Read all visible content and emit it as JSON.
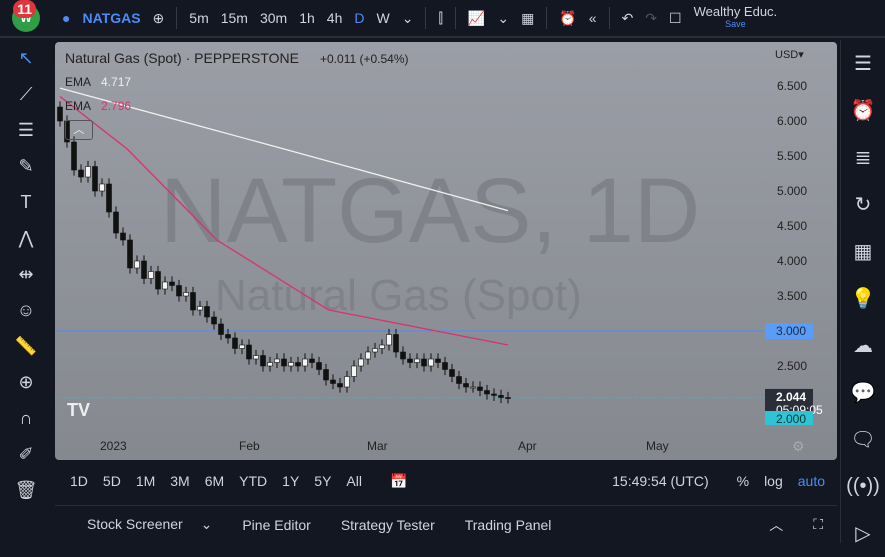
{
  "header": {
    "badge": "11",
    "symbol": "NATGAS",
    "intervals": [
      "5m",
      "15m",
      "30m",
      "1h",
      "4h",
      "D",
      "W"
    ],
    "active_interval": "D",
    "account": "Wealthy Educ.",
    "save": "Save"
  },
  "legend": {
    "title": "Natural Gas (Spot) · PEPPERSTONE",
    "change": "+0.011 (+0.54%)",
    "ema1_label": "EMA",
    "ema1_value": "4.717",
    "ema2_label": "EMA",
    "ema2_value": "2.796"
  },
  "watermark": {
    "line1": "NATGAS, 1D",
    "line2": "Natural Gas (Spot)"
  },
  "colors": {
    "ema1": "#f0f0f0",
    "ema2": "#d6336c",
    "hline": "#4e8bf5",
    "last": "#2ec4d6"
  },
  "chart_data": {
    "type": "candlestick",
    "currency": "USD▾",
    "yticks": [
      "6.500",
      "6.000",
      "5.500",
      "5.000",
      "4.500",
      "4.000",
      "3.500",
      "3.000",
      "2.500",
      "2.000"
    ],
    "ylim": [
      2.0,
      6.5
    ],
    "xticks": [
      "2023",
      "Feb",
      "Mar",
      "Apr",
      "May"
    ],
    "closes": [
      6.0,
      5.7,
      5.3,
      5.2,
      5.35,
      5.0,
      5.1,
      4.7,
      4.4,
      4.3,
      3.9,
      4.0,
      3.75,
      3.85,
      3.6,
      3.7,
      3.65,
      3.5,
      3.55,
      3.3,
      3.35,
      3.2,
      3.1,
      2.95,
      2.9,
      2.75,
      2.8,
      2.6,
      2.65,
      2.5,
      2.55,
      2.6,
      2.5,
      2.55,
      2.5,
      2.6,
      2.55,
      2.45,
      2.3,
      2.25,
      2.2,
      2.35,
      2.5,
      2.6,
      2.7,
      2.75,
      2.8,
      2.95,
      2.7,
      2.6,
      2.55,
      2.6,
      2.5,
      2.6,
      2.55,
      2.45,
      2.35,
      2.25,
      2.2,
      2.2,
      2.15,
      2.1,
      2.08,
      2.05,
      2.044
    ],
    "ema1": [
      [
        0,
        6.47
      ],
      [
        0.5,
        5.6
      ],
      [
        1,
        4.72
      ]
    ],
    "ema2": [
      [
        0,
        6.35
      ],
      [
        0.15,
        5.6
      ],
      [
        0.35,
        4.3
      ],
      [
        0.6,
        3.3
      ],
      [
        0.8,
        3.05
      ],
      [
        1,
        2.8
      ]
    ],
    "hline": "3.000",
    "last_price": "2.044",
    "countdown": "05:09:05",
    "level": "2.000"
  },
  "timebar": {
    "ranges": [
      "1D",
      "5D",
      "1M",
      "3M",
      "6M",
      "YTD",
      "1Y",
      "5Y",
      "All"
    ],
    "time": "15:49:54 (UTC)",
    "pct": "%",
    "log": "log",
    "auto": "auto"
  },
  "bottom": {
    "tabs": [
      "Stock Screener",
      "Pine Editor",
      "Strategy Tester",
      "Trading Panel"
    ]
  }
}
